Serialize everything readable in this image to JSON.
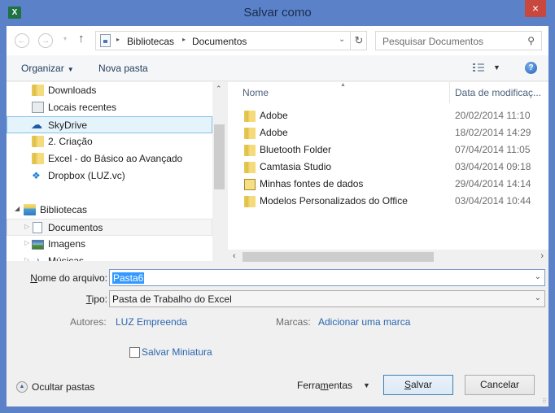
{
  "window": {
    "title": "Salvar como",
    "app_icon": "excel-icon",
    "close_label": "×"
  },
  "navigation": {
    "back_icon": "←",
    "forward_icon": "→",
    "recent_dropdown": "▾",
    "up_icon": "↑",
    "breadcrumb": [
      "Bibliotecas",
      "Documentos"
    ],
    "breadcrumb_separator": "▸",
    "address_dropdown": "⌄",
    "refresh_icon": "↻",
    "search_placeholder": "Pesquisar Documentos",
    "search_icon": "⚲"
  },
  "toolbar": {
    "organize_label": "Organizar",
    "new_folder_label": "Nova pasta",
    "help_label": "?"
  },
  "tree": {
    "items": [
      {
        "label": "Downloads",
        "icon": "downloads-folder-icon"
      },
      {
        "label": "Locais recentes",
        "icon": "recent-places-icon"
      },
      {
        "label": "SkyDrive",
        "icon": "skydrive-icon",
        "selected": true
      },
      {
        "label": "2. Criação",
        "icon": "folder-icon"
      },
      {
        "label": "Excel - do Básico ao Avançado",
        "icon": "folder-icon"
      },
      {
        "label": "Dropbox (LUZ.vc)",
        "icon": "dropbox-icon"
      },
      {
        "label": "Bibliotecas",
        "icon": "libraries-icon",
        "expanded": true
      },
      {
        "label": "Documentos",
        "icon": "documents-icon",
        "highlighted": true
      },
      {
        "label": "Imagens",
        "icon": "pictures-icon"
      },
      {
        "label": "Músicas",
        "icon": "music-icon"
      }
    ]
  },
  "filelist": {
    "columns": [
      "Nome",
      "Data de modificaç..."
    ],
    "rows": [
      {
        "name": "Adobe",
        "date": "20/02/2014 11:10",
        "icon": "folder-icon"
      },
      {
        "name": "Adobe",
        "date": "18/02/2014 14:29",
        "icon": "folder-icon"
      },
      {
        "name": "Bluetooth Folder",
        "date": "07/04/2014 11:05",
        "icon": "folder-icon"
      },
      {
        "name": "Camtasia Studio",
        "date": "03/04/2014 09:18",
        "icon": "folder-icon"
      },
      {
        "name": "Minhas fontes de dados",
        "date": "29/04/2014 14:14",
        "icon": "data-sources-folder-icon"
      },
      {
        "name": "Modelos Personalizados do Office",
        "date": "03/04/2014 10:44",
        "icon": "folder-icon"
      }
    ]
  },
  "form": {
    "filename_label_accel": "N",
    "filename_label_rest": "ome do arquivo:",
    "filename_value": "Pasta6",
    "type_label_accel": "T",
    "type_label_rest": "ipo:",
    "type_value": "Pasta de Trabalho do Excel",
    "authors_label": "Autores:",
    "authors_value": "LUZ Empreenda",
    "tags_label": "Marcas:",
    "tags_value": "Adicionar uma marca",
    "thumbnail_label": "Salvar Miniatura",
    "thumbnail_checked": false
  },
  "footer": {
    "hide_folders_label": "Ocultar pastas",
    "tools_pre": "Ferra",
    "tools_accel": "m",
    "tools_post": "entas",
    "save_accel": "S",
    "save_rest": "alvar",
    "cancel_label": "Cancelar"
  },
  "colors": {
    "title_bar": "#5b82c9",
    "close_button": "#c9483e",
    "selection": "#3399ff",
    "link": "#2a66b0"
  }
}
